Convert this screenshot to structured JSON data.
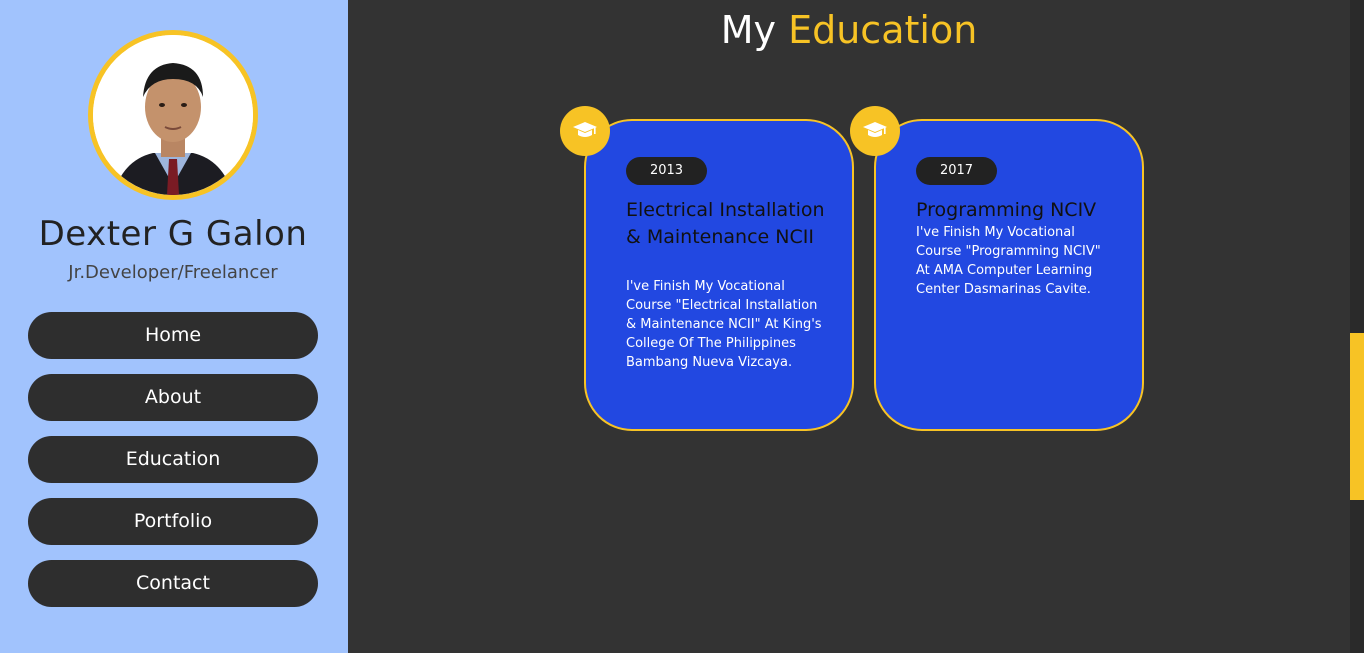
{
  "profile": {
    "name": "Dexter G Galon",
    "role": "Jr.Developer/Freelancer"
  },
  "nav": {
    "items": [
      {
        "label": "Home"
      },
      {
        "label": "About"
      },
      {
        "label": "Education"
      },
      {
        "label": "Portfolio"
      },
      {
        "label": "Contact"
      }
    ]
  },
  "main": {
    "title_prefix": "My",
    "title_accent": "Education"
  },
  "education": [
    {
      "year": "2013",
      "title": "Electrical Installation & Maintenance NCII",
      "description": "I've Finish My Vocational Course \"Electrical Installation & Maintenance NCII\" At King's College Of The Philippines Bambang Nueva Vizcaya.",
      "icon": "graduation-cap-icon"
    },
    {
      "year": "2017",
      "title": "Programming NCIV",
      "description": "I've Finish My Vocational Course \"Programming NCIV\" At AMA Computer Learning Center Dasmarinas Cavite.",
      "icon": "graduation-cap-icon"
    }
  ],
  "colors": {
    "accent": "#f7c325",
    "sidebar": "#a1c3fd",
    "card": "#2248e1",
    "background": "#333333"
  }
}
